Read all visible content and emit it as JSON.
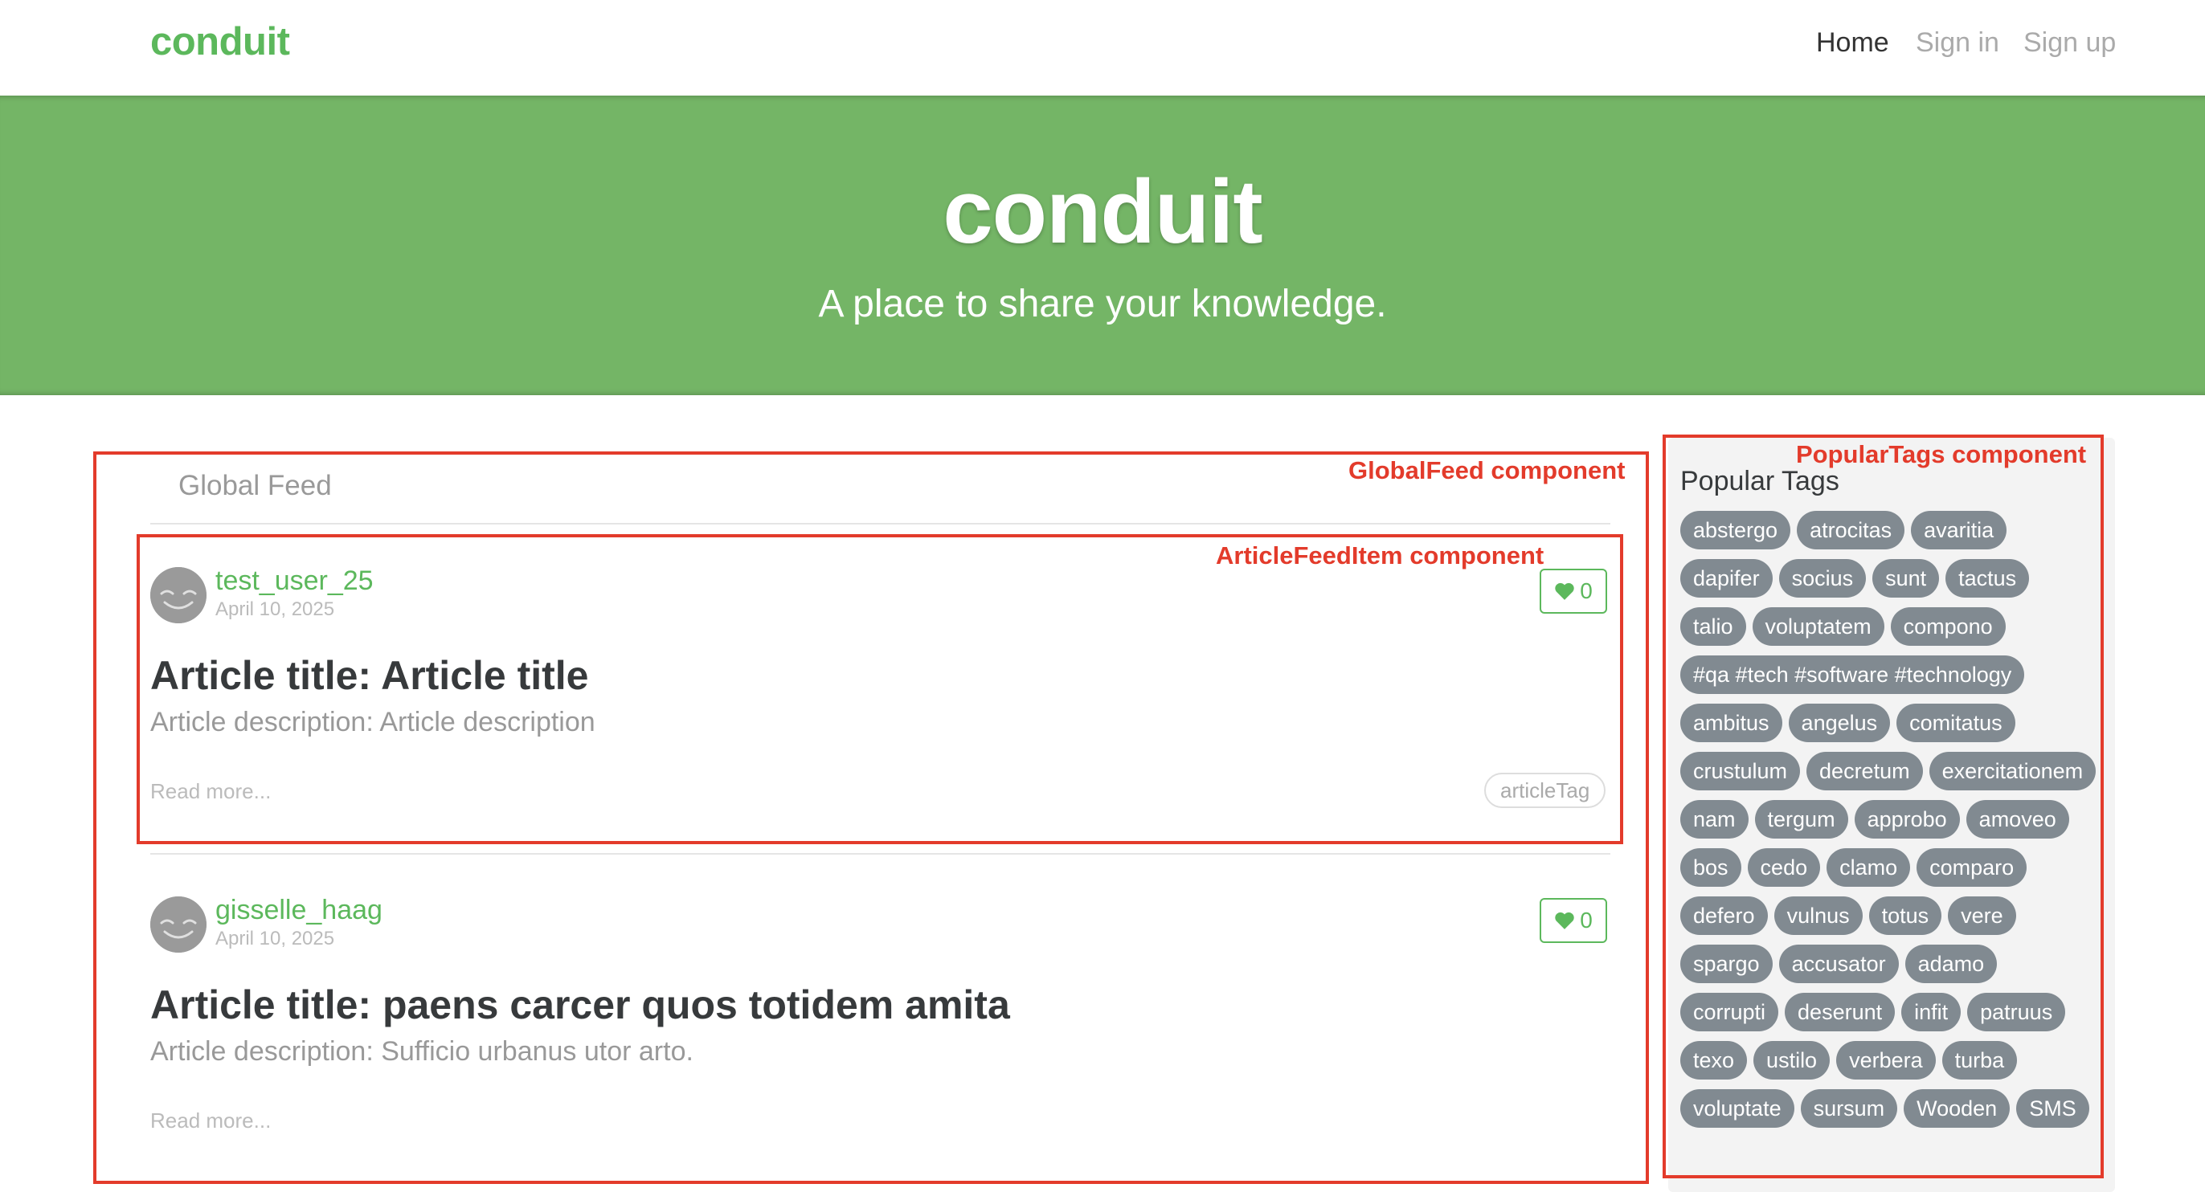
{
  "nav": {
    "brand": "conduit",
    "links": [
      "Home",
      "Sign in",
      "Sign up"
    ]
  },
  "banner": {
    "title": "conduit",
    "subtitle": "A place to share your knowledge."
  },
  "feed": {
    "tab": "Global Feed",
    "read_more": "Read more...",
    "articles": [
      {
        "author": "test_user_25",
        "date": "April 10, 2025",
        "likes": "0",
        "title": "Article title: Article title",
        "description": "Article description: Article description",
        "tag": "articleTag"
      },
      {
        "author": "gisselle_haag",
        "date": "April 10, 2025",
        "likes": "0",
        "title": "Article title: paens carcer quos totidem amita",
        "description": "Article description: Sufficio urbanus utor arto."
      }
    ]
  },
  "sidebar": {
    "title": "Popular Tags",
    "tags": [
      "abstergo",
      "atrocitas",
      "avaritia",
      "dapifer",
      "socius",
      "sunt",
      "tactus",
      "talio",
      "voluptatem",
      "compono",
      "#qa #tech #software #technology",
      "ambitus",
      "angelus",
      "comitatus",
      "crustulum",
      "decretum",
      "exercitationem",
      "nam",
      "tergum",
      "approbo",
      "amoveo",
      "bos",
      "cedo",
      "clamo",
      "comparo",
      "defero",
      "vulnus",
      "totus",
      "vere",
      "spargo",
      "accusator",
      "adamo",
      "corrupti",
      "deserunt",
      "infit",
      "patruus",
      "texo",
      "ustilo",
      "verbera",
      "turba",
      "voluptate",
      "sursum",
      "Wooden",
      "SMS"
    ]
  },
  "annotations": {
    "global_feed": "GlobalFeed component",
    "article_item": "ArticleFeedItem component",
    "popular_tags": "PopularTags component"
  },
  "colors": {
    "brand_green": "#5cb85c",
    "banner_green": "#74b566",
    "annotation_red": "#e33b2b",
    "tag_gray": "#818a91"
  }
}
